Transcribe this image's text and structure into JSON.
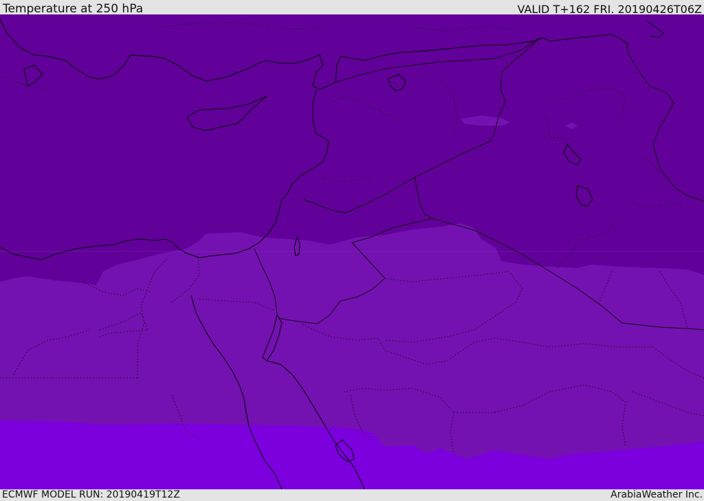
{
  "header": {
    "title": "Temperature at 250 hPa",
    "valid_time": "VALID T+162 FRI. 20190426T06Z"
  },
  "footer": {
    "model_run": "ECMWF MODEL RUN: 20190419T12Z",
    "credit": "ArabiaWeather Inc."
  },
  "map": {
    "colors": {
      "coldest_band": "#62009a",
      "middle_band": "#7411b1",
      "warm_band": "#7b00dd",
      "coastline": "#000000",
      "border": "#111111"
    },
    "bands": [
      "coldest",
      "middle",
      "warm"
    ]
  }
}
